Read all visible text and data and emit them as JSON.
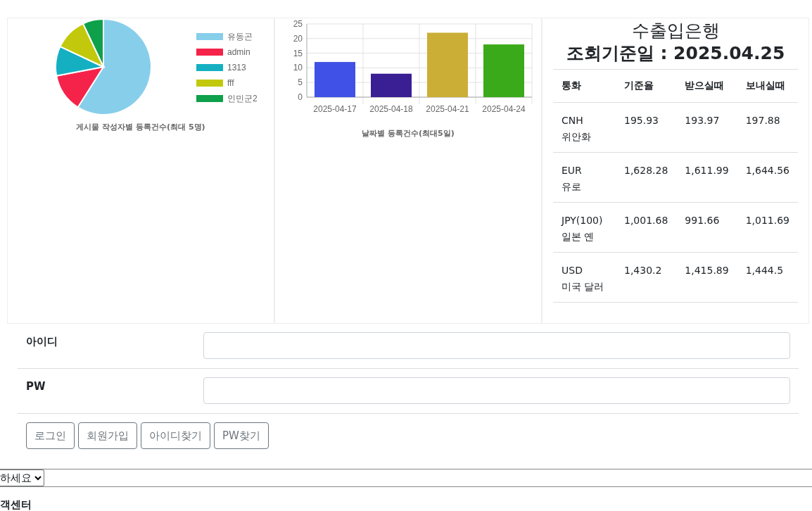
{
  "pie_panel": {
    "legend": [
      {
        "label": "유동곤",
        "color": "#87ceeb"
      },
      {
        "label": "admin",
        "color": "#f5234a"
      },
      {
        "label": "1313",
        "color": "#14b0c2"
      },
      {
        "label": "fff",
        "color": "#c2c90c"
      },
      {
        "label": "인민군2",
        "color": "#0ea04a"
      }
    ],
    "caption": "게시물 작성자별 등록건수(최대 5명)"
  },
  "bar_panel": {
    "chart_data": {
      "type": "bar",
      "title": "날짜별 등록건수(최대5일)",
      "categories": [
        "2025-04-17",
        "2025-04-18",
        "2025-04-21",
        "2025-04-24"
      ],
      "values": [
        12,
        8,
        22,
        18
      ],
      "grid": true,
      "colors": [
        "#3f51e6",
        "#3a1e94",
        "#cbae35",
        "#3aaa1a"
      ],
      "ylim": [
        0,
        25
      ],
      "yticks": [
        0,
        5,
        10,
        15,
        20,
        25
      ]
    }
  },
  "rate_panel": {
    "title": "수출입은행",
    "date_line": "조회기준일 : 2025.04.25",
    "columns": [
      "통화",
      "기준율",
      "받으실때",
      "보내실때"
    ],
    "rows": [
      {
        "code": "CNH",
        "name": "위안화",
        "base": "195.93",
        "receive": "193.97",
        "send": "197.88"
      },
      {
        "code": "EUR",
        "name": "유로",
        "base": "1,628.28",
        "receive": "1,611.99",
        "send": "1,644.56"
      },
      {
        "code": "JPY(100)",
        "name": "일본 옌",
        "base": "1,001.68",
        "receive": "991.66",
        "send": "1,011.69"
      },
      {
        "code": "USD",
        "name": "미국 달러",
        "base": "1,430.2",
        "receive": "1,415.89",
        "send": "1,444.5"
      }
    ]
  },
  "login_form": {
    "fields": [
      {
        "label": "아이디"
      },
      {
        "label": "PW"
      }
    ],
    "buttons": [
      "로그인",
      "회원가입",
      "아이디찾기",
      "PW찾기"
    ]
  },
  "select": {
    "value": "하세요"
  },
  "footer_heading": "객센터"
}
